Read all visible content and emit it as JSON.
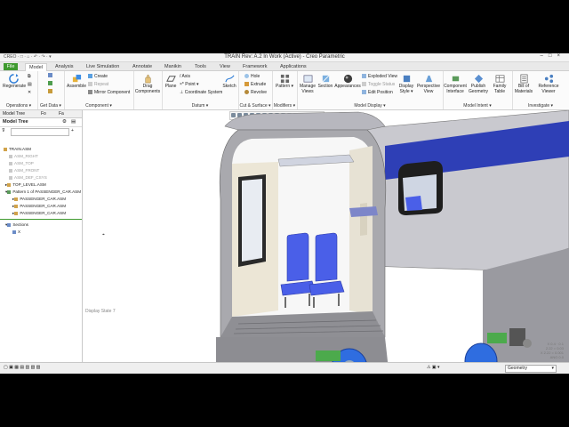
{
  "window": {
    "title": "TRAIN Rev: A.2 In Work (Active) - Creo Parametric",
    "quick_access": "CREO · □ · ⌂ · ↶ · ↷ · ▾"
  },
  "tabs": [
    "File",
    "Model",
    "Analysis",
    "Live Simulation",
    "Annotate",
    "Manikin",
    "Tools",
    "View",
    "Framework",
    "Applications"
  ],
  "ribbon": {
    "regenerate": "Regenerate",
    "operations": "Operations",
    "get_data": "Get Data",
    "assemble": "Assemble",
    "create": "Create",
    "repeat": "Repeat",
    "mirror_component": "Mirror Component",
    "component": "Component",
    "drag_components": "Drag Components",
    "plane": "Plane",
    "axis": "Axis",
    "point": "Point",
    "coordinate_system": "Coordinate System",
    "sketch": "Sketch",
    "datum": "Datum",
    "hole": "Hole",
    "extrude": "Extrude",
    "revolve": "Revolve",
    "cut_surface": "Cut & Surface",
    "pattern": "Pattern",
    "modifiers": "Modifiers",
    "manage_views": "Manage Views",
    "section": "Section",
    "appearances": "Appearances",
    "exploded_view": "Exploded View",
    "toggle_status": "Toggle Status",
    "edit_position": "Edit Position",
    "display_style": "Display Style",
    "perspective_view": "Perspective View",
    "model_display": "Model Display",
    "component_interface": "Component Interface",
    "publish_geometry": "Publish Geometry",
    "family_table": "Family Table",
    "model_intent": "Model Intent",
    "bill_of_materials": "Bill of Materials",
    "reference_viewer": "Reference Viewer",
    "investigate": "Investigate"
  },
  "left_panel": {
    "tabs": [
      "Model Tree",
      "Fo",
      "Fa"
    ],
    "header": "Model Tree",
    "tree": [
      {
        "label": "TRAIN.ASM",
        "indent": 0,
        "muted": false
      },
      {
        "label": "ASM_RIGHT",
        "indent": 1,
        "muted": true
      },
      {
        "label": "ASM_TOP",
        "indent": 1,
        "muted": true
      },
      {
        "label": "ASM_FRONT",
        "indent": 1,
        "muted": true
      },
      {
        "label": "ASM_DEF_CSYS",
        "indent": 1,
        "muted": true
      },
      {
        "label": "TOP_LEVEL.ASM",
        "indent": 1,
        "muted": false
      },
      {
        "label": "Pattern 1 of PASSENGER_CAR.ASM",
        "indent": 1,
        "muted": false
      },
      {
        "label": "PASSENGER_CAR.ASM",
        "indent": 2,
        "muted": false
      },
      {
        "label": "PASSENGER_CAR.ASM",
        "indent": 2,
        "muted": false
      },
      {
        "label": "PASSENGER_CAR.ASM",
        "indent": 2,
        "muted": false
      },
      {
        "label": "Sections",
        "indent": 0,
        "muted": false
      },
      {
        "label": "X",
        "indent": 1,
        "muted": false
      }
    ]
  },
  "viewport": {
    "display_state": "Display State 7",
    "coords": [
      "X 0.4 · 0.1",
      "2.22 = 0.03",
      "X 2.22 = 0.001",
      "ANG 0.0"
    ]
  },
  "statusbar": {
    "filter": "Geometry"
  },
  "colors": {
    "file_tab": "#3f9a2f",
    "car_blue": "#2e3fb6",
    "seat_blue": "#4a5fe8"
  }
}
